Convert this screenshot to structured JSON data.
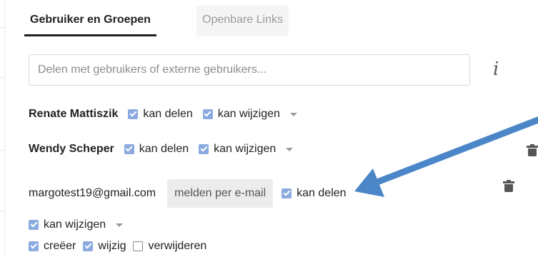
{
  "tabs": [
    {
      "label": "Gebruiker en Groepen",
      "active": true
    },
    {
      "label": "Openbare Links",
      "active": false
    }
  ],
  "search": {
    "placeholder": "Delen met gebruikers of externe gebruikers...",
    "info_glyph": "i"
  },
  "shares": [
    {
      "name": "Renate Mattiszik",
      "permissions": [
        {
          "label": "kan delen",
          "checked": true
        },
        {
          "label": "kan wijzigen",
          "checked": true
        }
      ]
    },
    {
      "name": "Wendy Scheper",
      "permissions": [
        {
          "label": "kan delen",
          "checked": true
        },
        {
          "label": "kan wijzigen",
          "checked": true
        }
      ]
    },
    {
      "name": "margotest19@gmail.com",
      "notify_label": "melden per e-mail",
      "permissions": [
        {
          "label": "kan delen",
          "checked": true
        },
        {
          "label": "kan wijzigen",
          "checked": true
        }
      ],
      "sub_permissions": [
        {
          "label": "creëer",
          "checked": true
        },
        {
          "label": "wijzig",
          "checked": true
        },
        {
          "label": "verwijderen",
          "checked": false
        }
      ]
    }
  ],
  "colors": {
    "checkbox_checked": "#8aaae0",
    "annotation_arrow": "#4a86c8",
    "active_tab_underline": "#222222"
  }
}
